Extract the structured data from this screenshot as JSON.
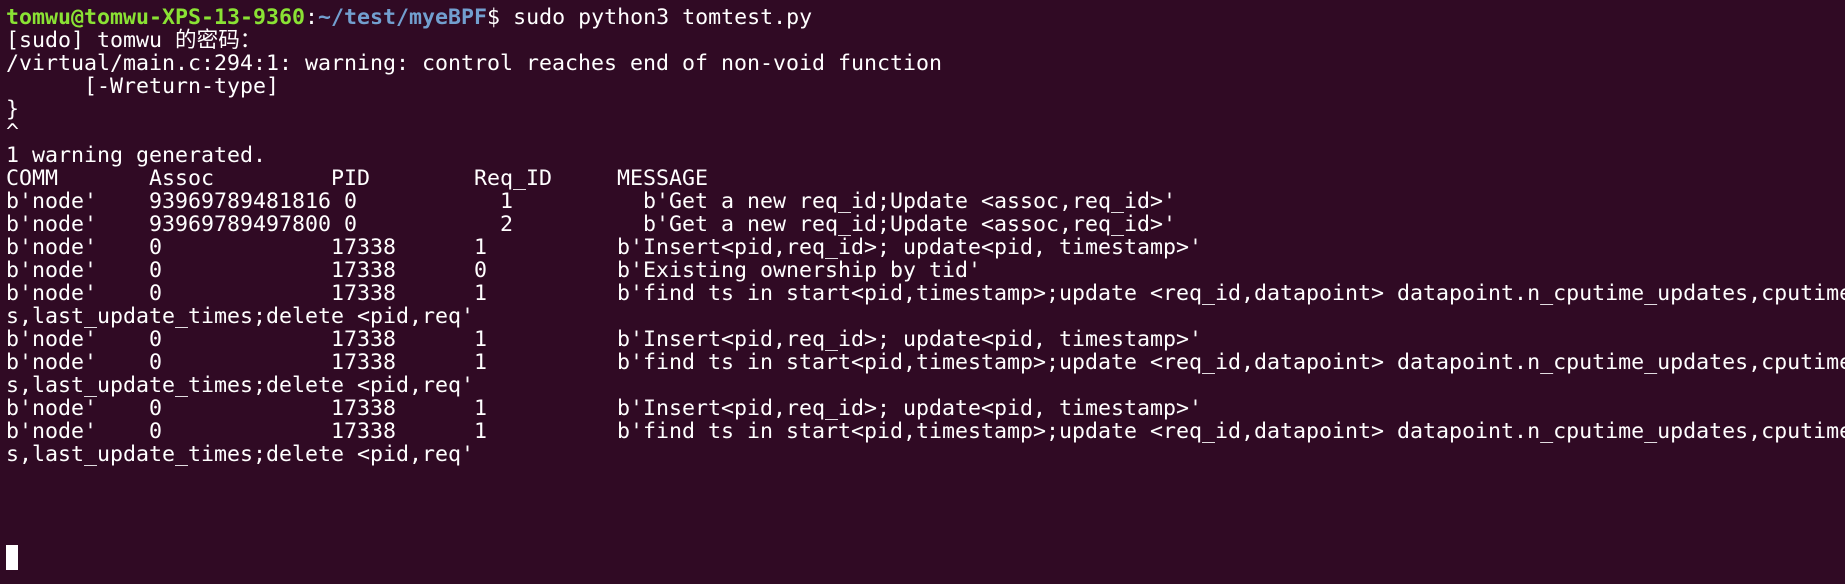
{
  "prompt": {
    "user_host": "tomwu@tomwu-XPS-13-9360",
    "separator": ":",
    "path": "~/test/myeBPF",
    "symbol": "$ ",
    "command": "sudo python3 tomtest.py"
  },
  "output_lines": [
    "[sudo] tomwu 的密码：",
    "/virtual/main.c:294:1: warning: control reaches end of non-void function",
    "      [-Wreturn-type]",
    "}",
    "^",
    "1 warning generated.",
    "COMM       Assoc         PID        Req_ID     MESSAGE",
    "b'node'    93969789481816 0           1          b'Get a new req_id;Update <assoc,req_id>'",
    "b'node'    93969789497800 0           2          b'Get a new req_id;Update <assoc,req_id>'",
    "b'node'    0             17338      1          b'Insert<pid,req_id>; update<pid, timestamp>'",
    "b'node'    0             17338      0          b'Existing ownership by tid'",
    "b'node'    0             17338      1          b'find ts in start<pid,timestamp>;update <req_id,datapoint> datapoint.n_cputime_updates,cputime",
    "s,last_update_times;delete <pid,req'",
    "b'node'    0             17338      1          b'Insert<pid,req_id>; update<pid, timestamp>'",
    "b'node'    0             17338      1          b'find ts in start<pid,timestamp>;update <req_id,datapoint> datapoint.n_cputime_updates,cputime",
    "s,last_update_times;delete <pid,req'",
    "b'node'    0             17338      1          b'Insert<pid,req_id>; update<pid, timestamp>'",
    "b'node'    0             17338      1          b'find ts in start<pid,timestamp>;update <req_id,datapoint> datapoint.n_cputime_updates,cputime",
    "s,last_update_times;delete <pid,req'"
  ],
  "colors": {
    "background": "#300a24",
    "text": "#ffffff",
    "prompt_user": "#8ae234",
    "prompt_path": "#729fcf"
  }
}
